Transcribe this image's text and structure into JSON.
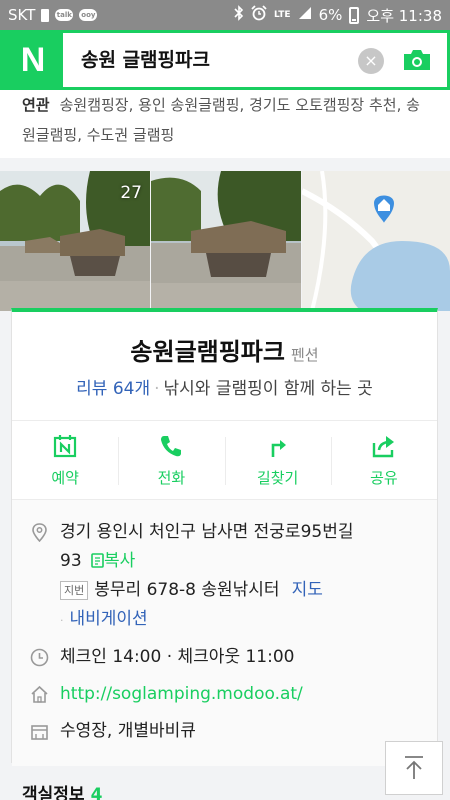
{
  "status_bar": {
    "carrier": "SKT",
    "chip_left": "talk",
    "chip_right": "ooy",
    "network": "LTE",
    "battery": "6%",
    "time": "오후 11:38"
  },
  "search": {
    "logo": "N",
    "query": "송원 글램핑파크",
    "clear_symbol": "×"
  },
  "related": {
    "label": "연관",
    "keywords": "송원캠핑장, 용인 송원글램핑, 경기도 오토캠핑장 추천, 송원글램핑, 수도권 글램핑"
  },
  "photos": {
    "count": "27"
  },
  "place": {
    "name": "송원글램핑파크",
    "category": "펜션",
    "review": "리뷰 64개",
    "description": "낚시와 글램핑이 함께 하는 곳"
  },
  "actions": {
    "reserve": "예약",
    "call": "전화",
    "directions": "길찾기",
    "share": "공유"
  },
  "info": {
    "address_line1": "경기 용인시 처인구 남사면 전궁로95번길",
    "address_line2": "93",
    "copy": "복사",
    "jibeon_badge": "지번",
    "jibeon_address": "봉무리 678-8 송원낚시터",
    "map": "지도",
    "navigation": "내비게이션",
    "hours": "체크인 14:00 · 체크아웃 11:00",
    "url": "http://soglamping.modoo.at/",
    "amenities": "수영장, 개별바비큐"
  },
  "bottom": {
    "section_title": "객실정보",
    "section_count": "4"
  },
  "colors": {
    "naver_green": "#19ce60",
    "link_blue": "#3263b8"
  }
}
